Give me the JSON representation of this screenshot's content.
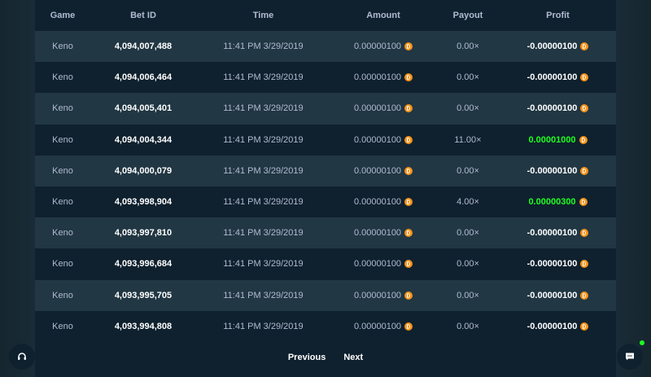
{
  "table": {
    "headers": [
      "Game",
      "Bet ID",
      "Time",
      "Amount",
      "Payout",
      "Profit"
    ],
    "rows": [
      {
        "game": "Keno",
        "bet_id": "4,094,007,488",
        "time": "11:41 PM 3/29/2019",
        "amount": "0.00000100",
        "payout": "0.00×",
        "profit": "-0.00000100",
        "win": false
      },
      {
        "game": "Keno",
        "bet_id": "4,094,006,464",
        "time": "11:41 PM 3/29/2019",
        "amount": "0.00000100",
        "payout": "0.00×",
        "profit": "-0.00000100",
        "win": false
      },
      {
        "game": "Keno",
        "bet_id": "4,094,005,401",
        "time": "11:41 PM 3/29/2019",
        "amount": "0.00000100",
        "payout": "0.00×",
        "profit": "-0.00000100",
        "win": false
      },
      {
        "game": "Keno",
        "bet_id": "4,094,004,344",
        "time": "11:41 PM 3/29/2019",
        "amount": "0.00000100",
        "payout": "11.00×",
        "profit": "0.00001000",
        "win": true
      },
      {
        "game": "Keno",
        "bet_id": "4,094,000,079",
        "time": "11:41 PM 3/29/2019",
        "amount": "0.00000100",
        "payout": "0.00×",
        "profit": "-0.00000100",
        "win": false
      },
      {
        "game": "Keno",
        "bet_id": "4,093,998,904",
        "time": "11:41 PM 3/29/2019",
        "amount": "0.00000100",
        "payout": "4.00×",
        "profit": "0.00000300",
        "win": true
      },
      {
        "game": "Keno",
        "bet_id": "4,093,997,810",
        "time": "11:41 PM 3/29/2019",
        "amount": "0.00000100",
        "payout": "0.00×",
        "profit": "-0.00000100",
        "win": false
      },
      {
        "game": "Keno",
        "bet_id": "4,093,996,684",
        "time": "11:41 PM 3/29/2019",
        "amount": "0.00000100",
        "payout": "0.00×",
        "profit": "-0.00000100",
        "win": false
      },
      {
        "game": "Keno",
        "bet_id": "4,093,995,705",
        "time": "11:41 PM 3/29/2019",
        "amount": "0.00000100",
        "payout": "0.00×",
        "profit": "-0.00000100",
        "win": false
      },
      {
        "game": "Keno",
        "bet_id": "4,093,994,808",
        "time": "11:41 PM 3/29/2019",
        "amount": "0.00000100",
        "payout": "0.00×",
        "profit": "-0.00000100",
        "win": false
      }
    ]
  },
  "pagination": {
    "previous_label": "Previous",
    "next_label": "Next"
  },
  "icons": {
    "currency": "bitcoin-coin-icon",
    "support": "headset-icon",
    "chat": "chat-bubble-icon"
  },
  "colors": {
    "background": "#1a2c38",
    "panel": "#0f212e",
    "row_alt": "#213743",
    "win": "#1fff20",
    "coin": "#f7931a",
    "muted_text": "#b1bad3"
  }
}
